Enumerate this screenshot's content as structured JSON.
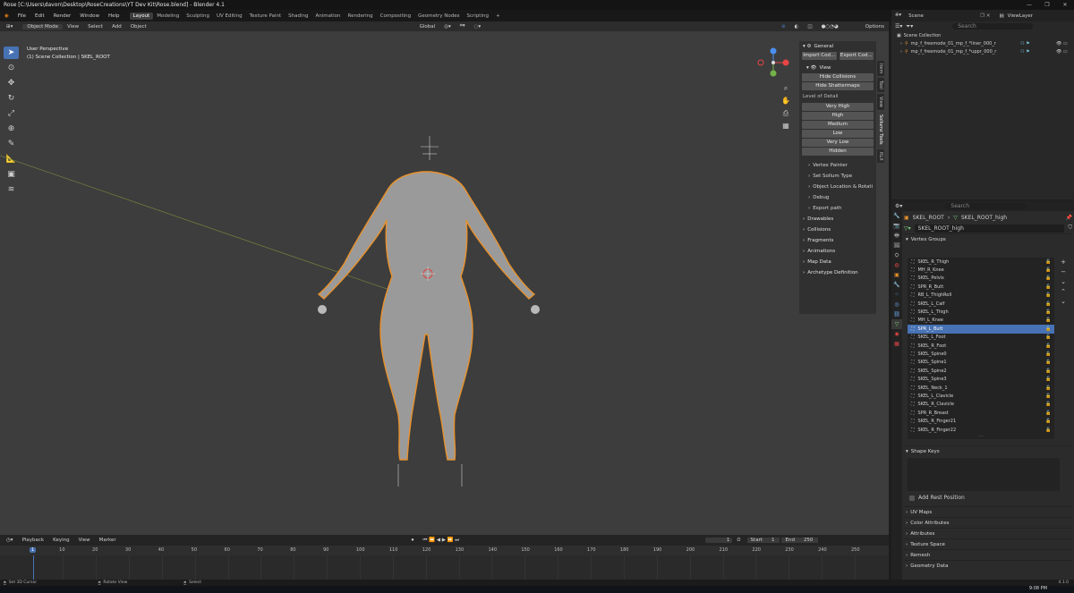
{
  "titlebar": {
    "title": "Rose [C:\\Users\\davon\\Desktop\\RoseCreations\\YT Dev Kit\\Rose.blend] - Blender 4.1",
    "minimize": "—",
    "maximize": "❐",
    "close": "✕"
  },
  "menus": [
    "File",
    "Edit",
    "Render",
    "Window",
    "Help"
  ],
  "workspaces": [
    "Layout",
    "Modeling",
    "Sculpting",
    "UV Editing",
    "Texture Paint",
    "Shading",
    "Animation",
    "Rendering",
    "Compositing",
    "Geometry Nodes",
    "Scripting"
  ],
  "scene": {
    "label": "Scene",
    "view_layer": "ViewLayer"
  },
  "viewport": {
    "mode": "Object Mode",
    "header_menus": [
      "View",
      "Select",
      "Add",
      "Object"
    ],
    "transform_orientation": "Global",
    "options_label": "Options",
    "info_line1": "User Perspective",
    "info_line2": "(1) Scene Collection | SKEL_ROOT"
  },
  "npanel": {
    "general": "General",
    "import_btn": "Import Cod...",
    "export_btn": "Export Cod...",
    "view": "View",
    "hide_collisions": "Hide Collisions",
    "hide_shattermaps": "Hide Shattermaps",
    "lod_label": "Level of Detail",
    "lod": [
      "Very High",
      "High",
      "Medium",
      "Low",
      "Very Low",
      "Hidden"
    ],
    "subs": [
      "Vertex Painter",
      "Set Sollum Type",
      "Object Location & Rotati",
      "Debug",
      "Export path"
    ],
    "sections": [
      "Drawables",
      "Collisions",
      "Fragments",
      "Animations",
      "Map Data",
      "Archetype Definition"
    ],
    "tabs": [
      "Item",
      "Tool",
      "View",
      "Sollumz Tools",
      "RLX"
    ]
  },
  "outliner": {
    "search_placeholder": "Search",
    "root": "Scene Collection",
    "rows": [
      "mp_f_freemode_01_mp_f_*liner_000_r",
      "mp_f_freemode_01_mp_f_*uppr_000_r"
    ]
  },
  "properties": {
    "search_placeholder": "Search",
    "breadcrumb_obj": "SKEL_ROOT",
    "breadcrumb_mesh": "SKEL_ROOT_high",
    "data_name": "SKEL_ROOT_high",
    "vertex_groups_title": "Vertex Groups",
    "vertex_groups": [
      "SKEL_R_Thigh",
      "MH_R_Knee",
      "SKEL_Pelvis",
      "SPR_R_Butt",
      "RB_L_ThighRoll",
      "SKEL_L_Calf",
      "SKEL_L_Thigh",
      "MH_L_Knee",
      "SPR_L_Butt",
      "SKEL_L_Foot",
      "SKEL_R_Foot",
      "SKEL_Spine0",
      "SKEL_Spine1",
      "SKEL_Spine2",
      "SKEL_Spine3",
      "SKEL_Neck_1",
      "SKEL_L_Clavicle",
      "SKEL_R_Clavicle",
      "SPR_R_Breast",
      "SKEL_R_Finger21",
      "SKEL_R_Finger22"
    ],
    "selected_group": "SPR_L_Butt",
    "shape_keys_title": "Shape Keys",
    "add_rest_position": "Add Rest Position",
    "more_sections": [
      "UV Maps",
      "Color Attributes",
      "Attributes",
      "Texture Space",
      "Remesh",
      "Geometry Data"
    ]
  },
  "timeline": {
    "menus": [
      "Playback",
      "Keying",
      "View",
      "Marker"
    ],
    "current_frame": "1",
    "start_label": "Start",
    "start": "1",
    "end_label": "End",
    "end": "250",
    "ticks": [
      "1",
      "10",
      "20",
      "30",
      "40",
      "50",
      "60",
      "70",
      "80",
      "90",
      "100",
      "110",
      "120",
      "130",
      "140",
      "150",
      "160",
      "170",
      "180",
      "190",
      "200",
      "210",
      "220",
      "230",
      "240",
      "250"
    ]
  },
  "statusbar": {
    "left": "Set 3D Cursor",
    "mid": "Rotate View",
    "right": "Select",
    "version": "4.1.0",
    "clock": "9:08 PM"
  },
  "colors": {
    "accent": "#4772b3",
    "selection_outline": "#e8912c",
    "viewport_bg": "#3d3d3d"
  }
}
